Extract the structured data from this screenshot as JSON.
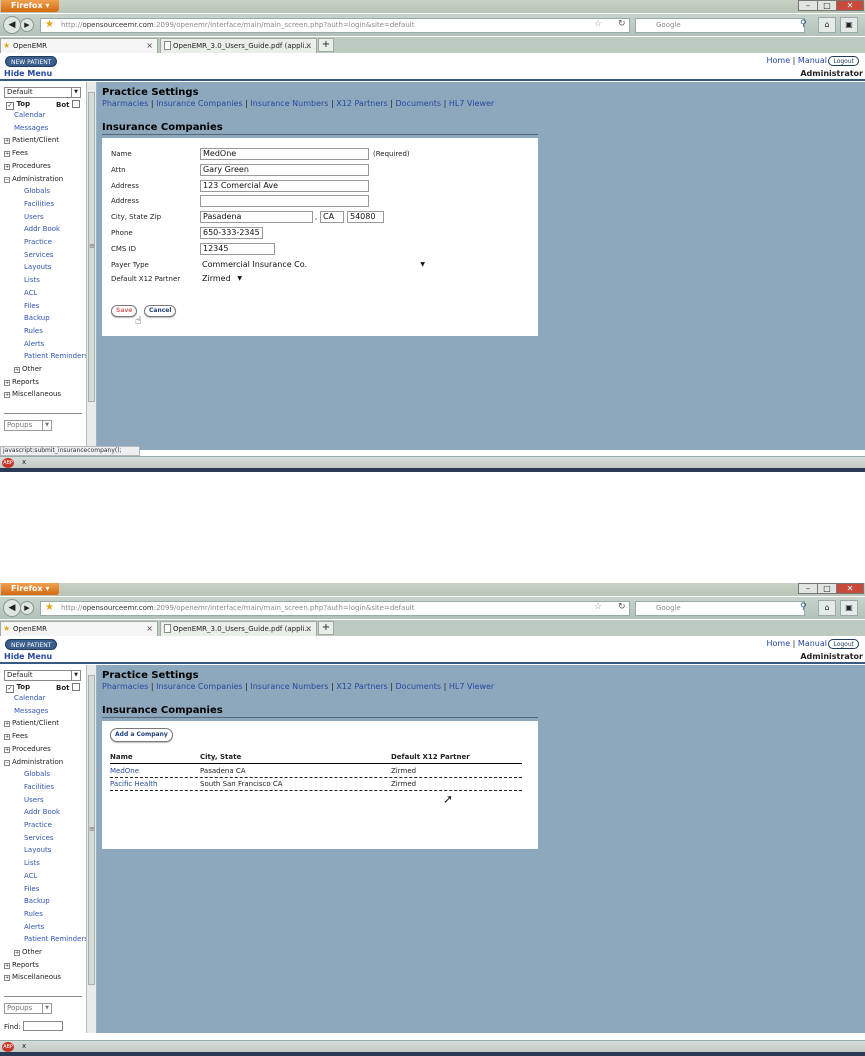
{
  "browser": {
    "menu_label": "Firefox",
    "url": "http://opensourceemr.com:2099/openemr/interface/main/main_screen.php?auth=login&site=default",
    "url_host": "opensourceemr.com",
    "url_prefix": "http://",
    "url_rest": ":2099/openemr/interface/main/main_screen.php?auth=login&site=default",
    "search_placeholder": "Google",
    "tabs": [
      {
        "label": "OpenEMR"
      },
      {
        "label": "OpenEMR_3.0_Users_Guide.pdf (appli..."
      }
    ],
    "status_text_1": "javascript:submit_insurancecompany();",
    "addon_close": "x"
  },
  "app": {
    "new_patient_label": "NEW PATIENT",
    "hide_menu_label": "Hide Menu",
    "home_link": "Home",
    "manual_link": "Manual",
    "logout_label": "Logout",
    "user_label": "Administrator"
  },
  "leftnav": {
    "facility": "Default",
    "top_label": "Top",
    "bot_label": "Bot",
    "items": [
      {
        "label": "Calendar",
        "indent": 1,
        "section": false
      },
      {
        "label": "Messages",
        "indent": 1,
        "section": false
      },
      {
        "label": "Patient/Client",
        "indent": 0,
        "section": true
      },
      {
        "label": "Fees",
        "indent": 0,
        "section": true
      },
      {
        "label": "Procedures",
        "indent": 0,
        "section": true
      },
      {
        "label": "Administration",
        "indent": 0,
        "section": true
      },
      {
        "label": "Globals",
        "indent": 2,
        "section": false
      },
      {
        "label": "Facilities",
        "indent": 2,
        "section": false
      },
      {
        "label": "Users",
        "indent": 2,
        "section": false
      },
      {
        "label": "Addr Book",
        "indent": 2,
        "section": false
      },
      {
        "label": "Practice",
        "indent": 2,
        "section": false
      },
      {
        "label": "Services",
        "indent": 2,
        "section": false
      },
      {
        "label": "Layouts",
        "indent": 2,
        "section": false
      },
      {
        "label": "Lists",
        "indent": 2,
        "section": false
      },
      {
        "label": "ACL",
        "indent": 2,
        "section": false
      },
      {
        "label": "Files",
        "indent": 2,
        "section": false
      },
      {
        "label": "Backup",
        "indent": 2,
        "section": false
      },
      {
        "label": "Rules",
        "indent": 2,
        "section": false
      },
      {
        "label": "Alerts",
        "indent": 2,
        "section": false
      },
      {
        "label": "Patient Reminders",
        "indent": 2,
        "section": false
      },
      {
        "label": "Other",
        "indent": 1,
        "section": true
      },
      {
        "label": "Reports",
        "indent": 0,
        "section": true
      },
      {
        "label": "Miscellaneous",
        "indent": 0,
        "section": true
      }
    ],
    "popups_label": "Popups",
    "find_label": "Find:"
  },
  "main": {
    "page_title": "Practice Settings",
    "subnav": [
      "Pharmacies",
      "Insurance Companies",
      "Insurance Numbers",
      "X12 Partners",
      "Documents",
      "HL7 Viewer"
    ],
    "section_title": "Insurance Companies"
  },
  "form": {
    "name_label": "Name",
    "name_value": "MedOne",
    "required_note": "(Required)",
    "attn_label": "Attn",
    "attn_value": "Gary Green",
    "address_label": "Address",
    "address_value": "123 Comercial Ave",
    "address2_label": "Address",
    "address2_value": "",
    "csz_label": "City, State Zip",
    "city_value": "Pasadena",
    "comma": ",",
    "state_value": "CA",
    "zip_value": "54080",
    "phone_label": "Phone",
    "phone_value": "650-333-2345",
    "cms_label": "CMS ID",
    "cms_value": "12345",
    "payer_label": "Payer Type",
    "payer_value": "Commercial Insurance Co.",
    "x12_label": "Default X12 Partner",
    "x12_value": "Zirmed",
    "save_label": "Save",
    "cancel_label": "Cancel"
  },
  "list": {
    "add_label": "Add a Company",
    "columns": [
      "Name",
      "City, State",
      "Default X12 Partner"
    ],
    "rows": [
      {
        "name": "MedOne",
        "city_state": "Pasadena CA",
        "partner": "Zirmed"
      },
      {
        "name": "Pacific Health",
        "city_state": "South San Francisco CA",
        "partner": "Zirmed"
      }
    ]
  }
}
